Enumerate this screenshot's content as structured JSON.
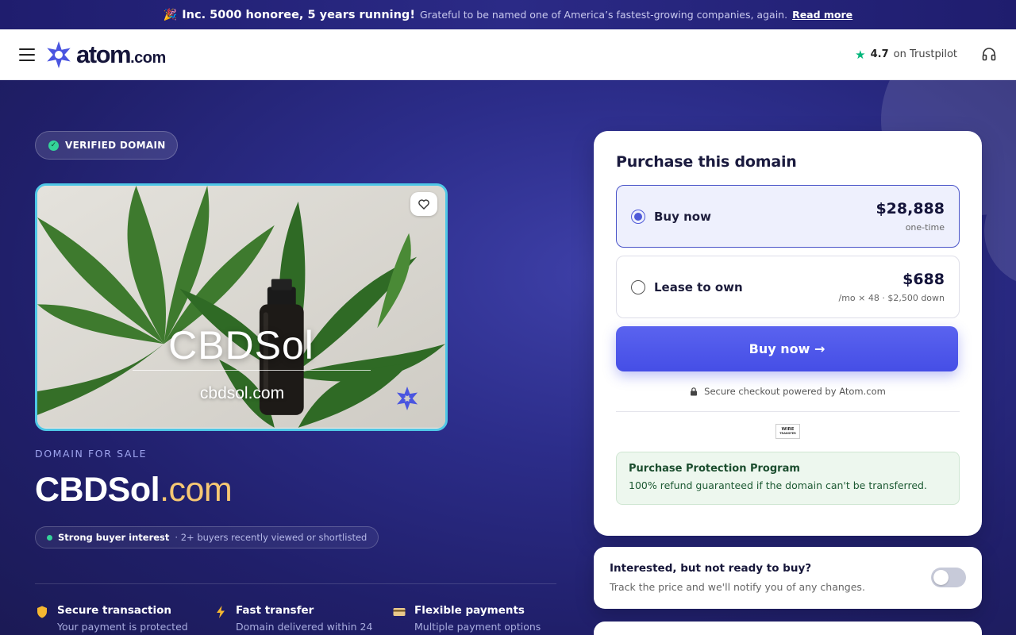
{
  "announcement": {
    "emoji": "🎉",
    "headline": "Inc. 5000 honoree, 5 years running!",
    "text": "Grateful to be named one of America’s fastest-growing companies, again.",
    "link": "Read more"
  },
  "header": {
    "logo_main": "atom",
    "logo_tld": ".com",
    "trust_score": "4.7",
    "trust_label": "on Trustpilot"
  },
  "hero": {
    "verified_label": "VERIFIED DOMAIN",
    "card_title": "CBDSol",
    "card_domain": "cbdsol.com",
    "sale_label": "DOMAIN FOR SALE",
    "domain_name": "CBDSol",
    "domain_tld": ".com",
    "interest_strong": "Strong buyer interest",
    "interest_sub": "· 2+ buyers recently viewed or shortlisted"
  },
  "features": [
    {
      "icon": "shield-icon",
      "title": "Secure transaction",
      "sub": "Your payment is protected"
    },
    {
      "icon": "lightning-icon",
      "title": "Fast transfer",
      "sub": "Domain delivered within 24"
    },
    {
      "icon": "card-icon",
      "title": "Flexible payments",
      "sub": "Multiple payment options"
    }
  ],
  "purchase": {
    "title": "Purchase this domain",
    "options": [
      {
        "label": "Buy now",
        "price": "$28,888",
        "sub": "one-time",
        "selected": true
      },
      {
        "label": "Lease to own",
        "price": "$688",
        "sub": "/mo × 48 · $2,500 down",
        "selected": false
      }
    ],
    "button": "Buy now →",
    "secure_text": "Secure checkout powered by Atom.com",
    "wire_line1": "WIRE",
    "wire_line2": "TRANSFER",
    "protection_title": "Purchase Protection Program",
    "protection_text": "100% refund guaranteed if the domain can't be transferred."
  },
  "notify": {
    "title": "Interested, but not ready to buy?",
    "text": "Track the price and we'll notify you of any changes.",
    "enabled": false
  },
  "colors": {
    "accent": "#4f5ad8",
    "background": "#2c2d8a",
    "tld_gold": "#f7c873",
    "success": "#34d399",
    "trustpilot": "#00b67a"
  }
}
